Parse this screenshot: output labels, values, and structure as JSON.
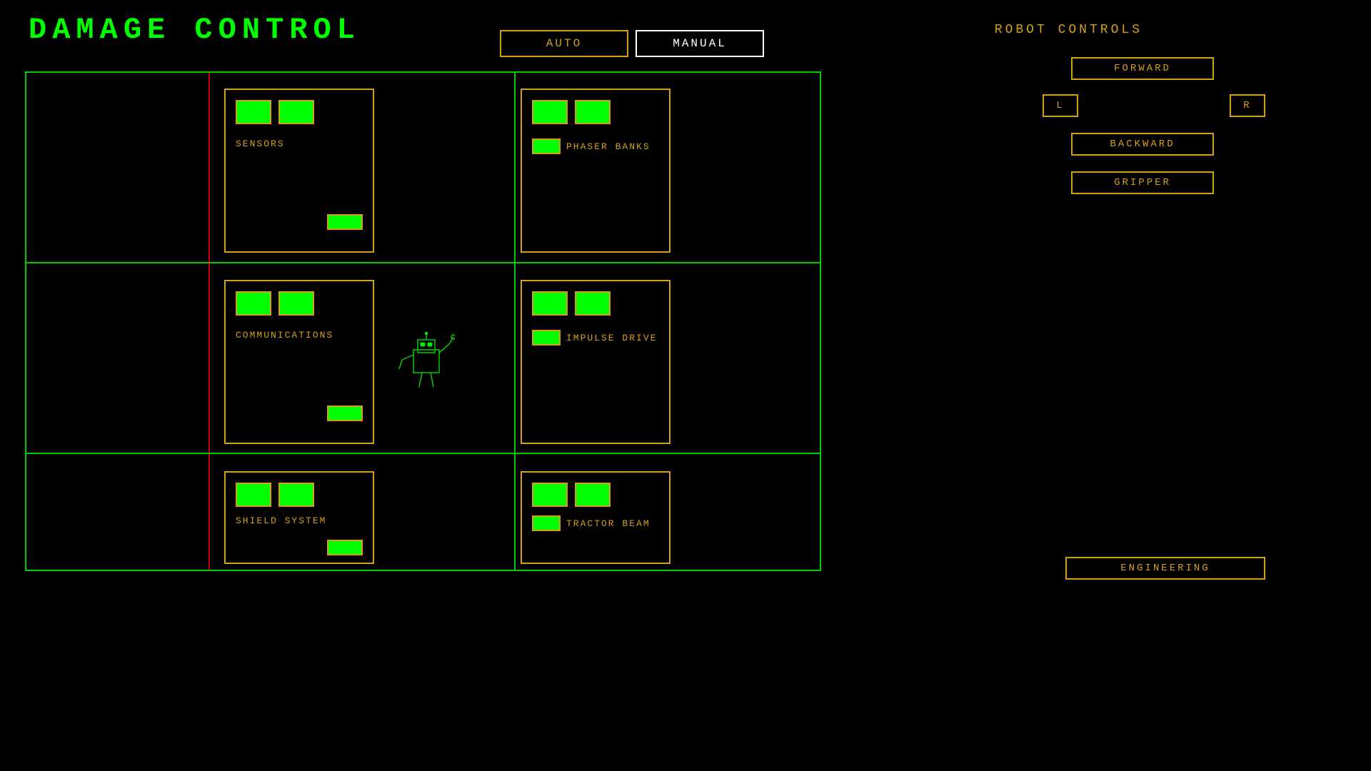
{
  "title": "DAMAGE   CONTROL",
  "mode_buttons": {
    "auto": "AUTO",
    "manual": "MANUAL"
  },
  "robot_controls": {
    "label": "ROBOT   CONTROLS",
    "forward": "FORWARD",
    "left": "L",
    "right": "R",
    "backward": "BACKWARD",
    "gripper": "GRIPPER"
  },
  "engineering_btn": "ENGINEERING",
  "modules": [
    {
      "id": "sensors",
      "label": "SENSORS",
      "col": 0,
      "row": 0
    },
    {
      "id": "phaser_banks",
      "label": "PHASER  BANKS",
      "col": 1,
      "row": 0
    },
    {
      "id": "communications",
      "label": "COMMUNICATIONS",
      "col": 0,
      "row": 1
    },
    {
      "id": "impulse_drive",
      "label": "IMPULSE  DRIVE",
      "col": 1,
      "row": 1
    },
    {
      "id": "shield_system",
      "label": "SHIELD  SYSTEM",
      "col": 0,
      "row": 2
    },
    {
      "id": "tractor_beam",
      "label": "TRACTOR  BEAM",
      "col": 1,
      "row": 2
    }
  ],
  "colors": {
    "green": "#00ff00",
    "gold": "#d4a017",
    "red": "#cc0000",
    "bg": "#000000"
  }
}
